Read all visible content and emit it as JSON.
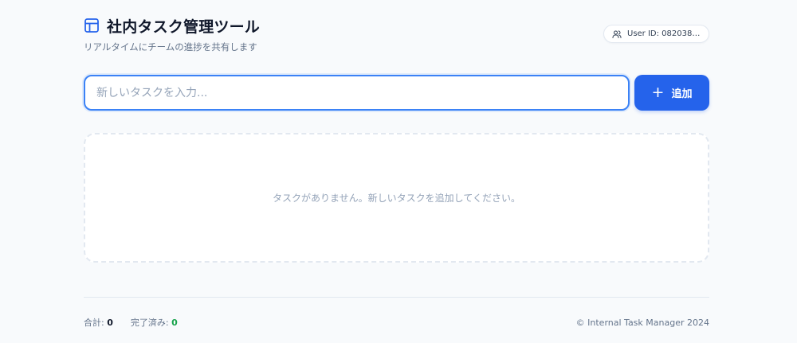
{
  "header": {
    "title": "社内タスク管理ツール",
    "subtitle": "リアルタイムにチームの進捗を共有します",
    "icon": "layout-icon",
    "user_badge": {
      "icon": "users-icon",
      "label": "User ID: 08203807..."
    }
  },
  "task_form": {
    "input_placeholder": "新しいタスクを入力...",
    "input_value": "",
    "add_button_icon": "plus-icon",
    "add_button_label": "追加"
  },
  "task_list": {
    "empty_message": "タスクがありません。新しいタスクを追加してください。"
  },
  "footer": {
    "total_label": "合計:",
    "total_value": "0",
    "completed_label": "完了済み:",
    "completed_value": "0",
    "copyright": "© Internal Task Manager 2024"
  },
  "colors": {
    "accent": "#2563eb",
    "input_border": "#3b82f6",
    "completed": "#16a34a",
    "background": "#f8fafc"
  }
}
